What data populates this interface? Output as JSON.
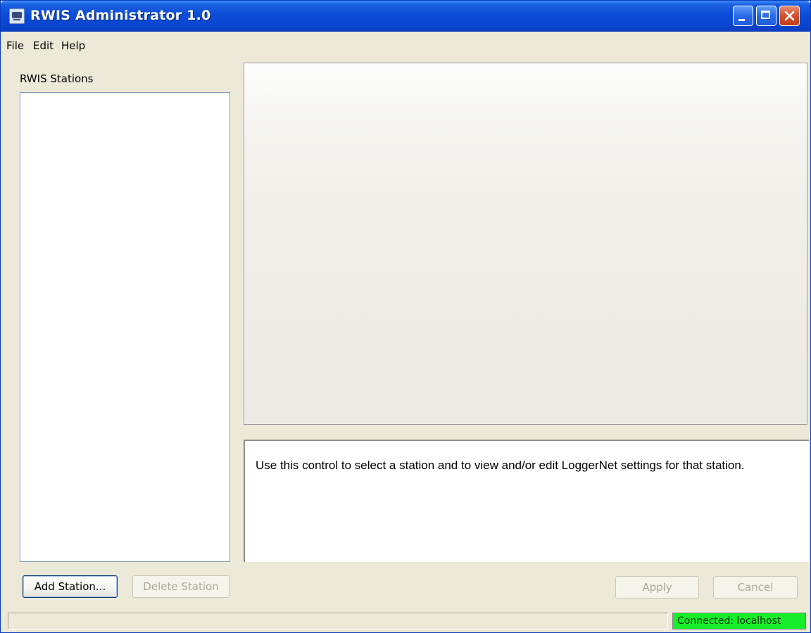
{
  "window": {
    "title": "RWIS Administrator 1.0",
    "icon": "app-icon",
    "controls": [
      "minimize",
      "maximize",
      "close"
    ]
  },
  "menu": {
    "items": [
      "File",
      "Edit",
      "Help"
    ]
  },
  "stations": {
    "label": "RWIS Stations",
    "items": []
  },
  "description": {
    "text": "Use this control to select a station and to view and/or edit LoggerNet settings for that station."
  },
  "buttons": {
    "add_station": "Add Station...",
    "delete_station": "Delete Station",
    "apply": "Apply",
    "cancel": "Cancel"
  },
  "status": {
    "left": "",
    "connection": "Connected: localhost",
    "connection_color": "#17ee2a"
  },
  "colors": {
    "titlebar": "#0b4bd6",
    "window_bg": "#ece9d8"
  }
}
